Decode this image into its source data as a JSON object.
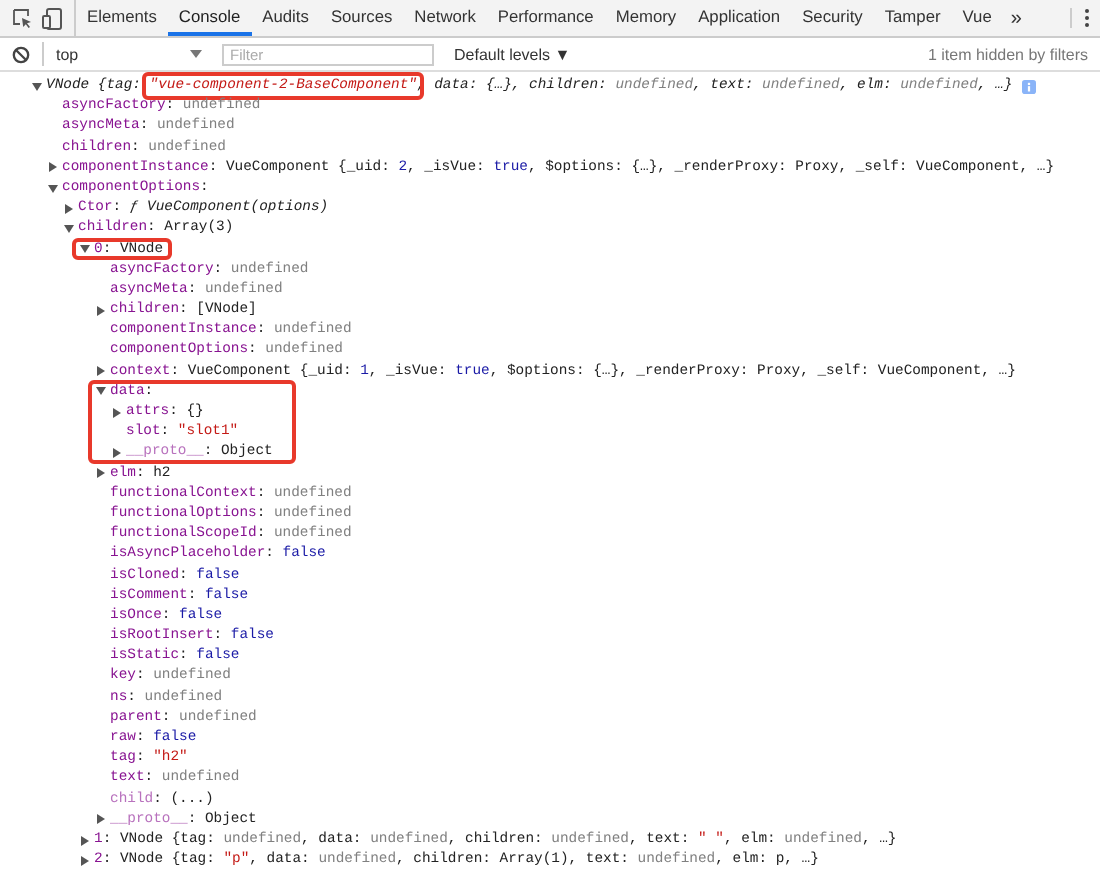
{
  "tabs": [
    {
      "label": "Elements",
      "selected": false
    },
    {
      "label": "Console",
      "selected": true
    },
    {
      "label": "Audits",
      "selected": false
    },
    {
      "label": "Sources",
      "selected": false
    },
    {
      "label": "Network",
      "selected": false
    },
    {
      "label": "Performance",
      "selected": false
    },
    {
      "label": "Memory",
      "selected": false
    },
    {
      "label": "Application",
      "selected": false
    },
    {
      "label": "Security",
      "selected": false
    },
    {
      "label": "Tamper",
      "selected": false
    },
    {
      "label": "Vue",
      "selected": false
    }
  ],
  "more_tabs": "»",
  "filter_bar": {
    "context": "top",
    "filter": {
      "placeholder": "Filter"
    },
    "levels": "Default levels ▼",
    "hidden_note": "1 item hidden by filters"
  },
  "console": [
    {
      "expanded": true,
      "parts": [
        {
          "kind": "plain",
          "t": "VNode {tag: "
        },
        {
          "kind": "string",
          "t": "\"vue-component-2-BaseComponent\"",
          "highlighted": true
        },
        {
          "kind": "plain",
          "t": ", data: {…}, children: "
        },
        {
          "kind": "undefined",
          "t": "undefined"
        },
        {
          "kind": "plain",
          "t": ", text: "
        },
        {
          "kind": "undefined",
          "t": "undefined"
        },
        {
          "kind": "plain",
          "t": ", elm: "
        },
        {
          "kind": "undefined",
          "t": "undefined"
        },
        {
          "kind": "plain",
          "t": ", …}"
        }
      ],
      "children": [
        {
          "parts": [
            {
              "kind": "key",
              "t": "asyncFactory"
            },
            {
              "kind": "plain",
              "t": ": "
            },
            {
              "kind": "undefined",
              "t": "undefined"
            }
          ]
        },
        {
          "parts": [
            {
              "kind": "key",
              "t": "asyncMeta"
            },
            {
              "kind": "plain",
              "t": ": "
            },
            {
              "kind": "undefined",
              "t": "undefined"
            }
          ]
        },
        {
          "parts": [
            {
              "kind": "key",
              "t": "children"
            },
            {
              "kind": "plain",
              "t": ": "
            },
            {
              "kind": "undefined",
              "t": "undefined"
            }
          ]
        },
        {
          "expanded": false,
          "parts": [
            {
              "kind": "key",
              "t": "componentInstance"
            },
            {
              "kind": "plain",
              "t": ": VueComponent {_uid: "
            },
            {
              "kind": "keyword",
              "t": "2"
            },
            {
              "kind": "plain",
              "t": ", _isVue: "
            },
            {
              "kind": "keyword",
              "t": "true"
            },
            {
              "kind": "plain",
              "t": ", $options: {…}, _renderProxy: Proxy, _self: VueComponent, …}"
            }
          ]
        },
        {
          "expanded": true,
          "parts": [
            {
              "kind": "key",
              "t": "componentOptions"
            },
            {
              "kind": "plain",
              "t": ":"
            }
          ],
          "children": [
            {
              "expanded": false,
              "parts": [
                {
                  "kind": "key",
                  "t": "Ctor"
                },
                {
                  "kind": "plain",
                  "t": ": "
                },
                {
                  "kind": "func",
                  "t": "ƒ VueComponent(options)"
                }
              ]
            },
            {
              "expanded": true,
              "parts": [
                {
                  "kind": "key",
                  "t": "children"
                },
                {
                  "kind": "plain",
                  "t": ": Array(3)"
                }
              ],
              "children": [
                {
                  "expanded": true,
                  "highlight": {
                    "kind": "row"
                  },
                  "parts": [
                    {
                      "kind": "key",
                      "t": "0"
                    },
                    {
                      "kind": "plain",
                      "t": ": VNode"
                    }
                  ],
                  "children": [
                    {
                      "parts": [
                        {
                          "kind": "key",
                          "t": "asyncFactory"
                        },
                        {
                          "kind": "plain",
                          "t": ": "
                        },
                        {
                          "kind": "undefined",
                          "t": "undefined"
                        }
                      ]
                    },
                    {
                      "parts": [
                        {
                          "kind": "key",
                          "t": "asyncMeta"
                        },
                        {
                          "kind": "plain",
                          "t": ": "
                        },
                        {
                          "kind": "undefined",
                          "t": "undefined"
                        }
                      ]
                    },
                    {
                      "expanded": false,
                      "parts": [
                        {
                          "kind": "key",
                          "t": "children"
                        },
                        {
                          "kind": "plain",
                          "t": ": [VNode]"
                        }
                      ]
                    },
                    {
                      "parts": [
                        {
                          "kind": "key",
                          "t": "componentInstance"
                        },
                        {
                          "kind": "plain",
                          "t": ": "
                        },
                        {
                          "kind": "undefined",
                          "t": "undefined"
                        }
                      ]
                    },
                    {
                      "parts": [
                        {
                          "kind": "key",
                          "t": "componentOptions"
                        },
                        {
                          "kind": "plain",
                          "t": ": "
                        },
                        {
                          "kind": "undefined",
                          "t": "undefined"
                        }
                      ]
                    },
                    {
                      "expanded": false,
                      "parts": [
                        {
                          "kind": "key",
                          "t": "context"
                        },
                        {
                          "kind": "plain",
                          "t": ": VueComponent {_uid: "
                        },
                        {
                          "kind": "keyword",
                          "t": "1"
                        },
                        {
                          "kind": "plain",
                          "t": ", _isVue: "
                        },
                        {
                          "kind": "keyword",
                          "t": "true"
                        },
                        {
                          "kind": "plain",
                          "t": ", $options: {…}, _renderProxy: Proxy, _self: VueComponent, …}"
                        }
                      ]
                    },
                    {
                      "expanded": true,
                      "highlight": {
                        "kind": "block"
                      },
                      "parts": [
                        {
                          "kind": "key",
                          "t": "data"
                        },
                        {
                          "kind": "plain",
                          "t": ":"
                        }
                      ],
                      "children": [
                        {
                          "expanded": false,
                          "parts": [
                            {
                              "kind": "key",
                              "t": "attrs"
                            },
                            {
                              "kind": "plain",
                              "t": ": {}"
                            }
                          ]
                        },
                        {
                          "parts": [
                            {
                              "kind": "key",
                              "t": "slot"
                            },
                            {
                              "kind": "plain",
                              "t": ": "
                            },
                            {
                              "kind": "string",
                              "t": "\"slot1\""
                            }
                          ]
                        },
                        {
                          "expanded": false,
                          "parts": [
                            {
                              "kind": "dimkey",
                              "t": "__proto__"
                            },
                            {
                              "kind": "plain",
                              "t": ": Object"
                            }
                          ]
                        }
                      ]
                    },
                    {
                      "expanded": false,
                      "parts": [
                        {
                          "kind": "key",
                          "t": "elm"
                        },
                        {
                          "kind": "plain",
                          "t": ": h2"
                        }
                      ]
                    },
                    {
                      "parts": [
                        {
                          "kind": "key",
                          "t": "functionalContext"
                        },
                        {
                          "kind": "plain",
                          "t": ": "
                        },
                        {
                          "kind": "undefined",
                          "t": "undefined"
                        }
                      ]
                    },
                    {
                      "parts": [
                        {
                          "kind": "key",
                          "t": "functionalOptions"
                        },
                        {
                          "kind": "plain",
                          "t": ": "
                        },
                        {
                          "kind": "undefined",
                          "t": "undefined"
                        }
                      ]
                    },
                    {
                      "parts": [
                        {
                          "kind": "key",
                          "t": "functionalScopeId"
                        },
                        {
                          "kind": "plain",
                          "t": ": "
                        },
                        {
                          "kind": "undefined",
                          "t": "undefined"
                        }
                      ]
                    },
                    {
                      "parts": [
                        {
                          "kind": "key",
                          "t": "isAsyncPlaceholder"
                        },
                        {
                          "kind": "plain",
                          "t": ": "
                        },
                        {
                          "kind": "keyword",
                          "t": "false"
                        }
                      ]
                    },
                    {
                      "parts": [
                        {
                          "kind": "key",
                          "t": "isCloned"
                        },
                        {
                          "kind": "plain",
                          "t": ": "
                        },
                        {
                          "kind": "keyword",
                          "t": "false"
                        }
                      ]
                    },
                    {
                      "parts": [
                        {
                          "kind": "key",
                          "t": "isComment"
                        },
                        {
                          "kind": "plain",
                          "t": ": "
                        },
                        {
                          "kind": "keyword",
                          "t": "false"
                        }
                      ]
                    },
                    {
                      "parts": [
                        {
                          "kind": "key",
                          "t": "isOnce"
                        },
                        {
                          "kind": "plain",
                          "t": ": "
                        },
                        {
                          "kind": "keyword",
                          "t": "false"
                        }
                      ]
                    },
                    {
                      "parts": [
                        {
                          "kind": "key",
                          "t": "isRootInsert"
                        },
                        {
                          "kind": "plain",
                          "t": ": "
                        },
                        {
                          "kind": "keyword",
                          "t": "false"
                        }
                      ]
                    },
                    {
                      "parts": [
                        {
                          "kind": "key",
                          "t": "isStatic"
                        },
                        {
                          "kind": "plain",
                          "t": ": "
                        },
                        {
                          "kind": "keyword",
                          "t": "false"
                        }
                      ]
                    },
                    {
                      "parts": [
                        {
                          "kind": "key",
                          "t": "key"
                        },
                        {
                          "kind": "plain",
                          "t": ": "
                        },
                        {
                          "kind": "undefined",
                          "t": "undefined"
                        }
                      ]
                    },
                    {
                      "parts": [
                        {
                          "kind": "key",
                          "t": "ns"
                        },
                        {
                          "kind": "plain",
                          "t": ": "
                        },
                        {
                          "kind": "undefined",
                          "t": "undefined"
                        }
                      ]
                    },
                    {
                      "parts": [
                        {
                          "kind": "key",
                          "t": "parent"
                        },
                        {
                          "kind": "plain",
                          "t": ": "
                        },
                        {
                          "kind": "undefined",
                          "t": "undefined"
                        }
                      ]
                    },
                    {
                      "parts": [
                        {
                          "kind": "key",
                          "t": "raw"
                        },
                        {
                          "kind": "plain",
                          "t": ": "
                        },
                        {
                          "kind": "keyword",
                          "t": "false"
                        }
                      ]
                    },
                    {
                      "parts": [
                        {
                          "kind": "key",
                          "t": "tag"
                        },
                        {
                          "kind": "plain",
                          "t": ": "
                        },
                        {
                          "kind": "string",
                          "t": "\"h2\""
                        }
                      ]
                    },
                    {
                      "parts": [
                        {
                          "kind": "key",
                          "t": "text"
                        },
                        {
                          "kind": "plain",
                          "t": ": "
                        },
                        {
                          "kind": "undefined",
                          "t": "undefined"
                        }
                      ]
                    },
                    {
                      "parts": [
                        {
                          "kind": "dimkey",
                          "t": "child"
                        },
                        {
                          "kind": "plain",
                          "t": ": (...)"
                        }
                      ]
                    },
                    {
                      "expanded": false,
                      "parts": [
                        {
                          "kind": "dimkey",
                          "t": "__proto__"
                        },
                        {
                          "kind": "plain",
                          "t": ": Object"
                        }
                      ]
                    }
                  ]
                },
                {
                  "expanded": false,
                  "parts": [
                    {
                      "kind": "key",
                      "t": "1"
                    },
                    {
                      "kind": "plain",
                      "t": ": VNode {tag: "
                    },
                    {
                      "kind": "undefined",
                      "t": "undefined"
                    },
                    {
                      "kind": "plain",
                      "t": ", data: "
                    },
                    {
                      "kind": "undefined",
                      "t": "undefined"
                    },
                    {
                      "kind": "plain",
                      "t": ", children: "
                    },
                    {
                      "kind": "undefined",
                      "t": "undefined"
                    },
                    {
                      "kind": "plain",
                      "t": ", text: "
                    },
                    {
                      "kind": "string",
                      "t": "\" \""
                    },
                    {
                      "kind": "plain",
                      "t": ", elm: "
                    },
                    {
                      "kind": "undefined",
                      "t": "undefined"
                    },
                    {
                      "kind": "plain",
                      "t": ", …}"
                    }
                  ]
                },
                {
                  "expanded": false,
                  "parts": [
                    {
                      "kind": "key",
                      "t": "2"
                    },
                    {
                      "kind": "plain",
                      "t": ": VNode {tag: "
                    },
                    {
                      "kind": "string",
                      "t": "\"p\""
                    },
                    {
                      "kind": "plain",
                      "t": ", data: "
                    },
                    {
                      "kind": "undefined",
                      "t": "undefined"
                    },
                    {
                      "kind": "plain",
                      "t": ", children: Array(1), text: "
                    },
                    {
                      "kind": "undefined",
                      "t": "undefined"
                    },
                    {
                      "kind": "plain",
                      "t": ", elm: p, …}"
                    }
                  ]
                }
              ]
            }
          ]
        }
      ]
    }
  ]
}
